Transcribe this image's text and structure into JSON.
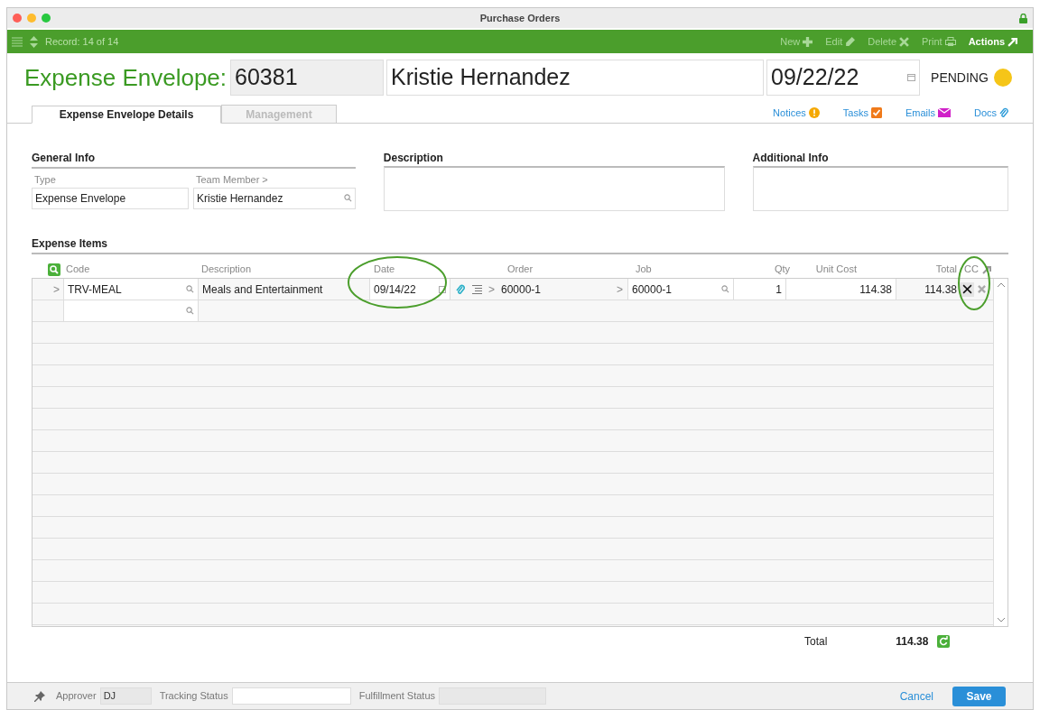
{
  "window": {
    "title": "Purchase Orders"
  },
  "toolbar": {
    "record": "Record: 14 of 14",
    "actions": [
      {
        "label": "New",
        "kind": "plus",
        "disabled": true
      },
      {
        "label": "Edit",
        "kind": "pencil",
        "disabled": true
      },
      {
        "label": "Delete",
        "kind": "x",
        "disabled": true
      },
      {
        "label": "Print",
        "kind": "printer",
        "disabled": true
      },
      {
        "label": "Actions",
        "kind": "arrow",
        "disabled": false
      }
    ]
  },
  "header": {
    "title": "Expense Envelope:",
    "number": "60381",
    "name": "Kristie Hernandez",
    "date": "09/22/22",
    "status": {
      "label": "PENDING",
      "color": "#f5c518"
    }
  },
  "tabs": [
    {
      "label": "Expense Envelope Details",
      "selected": true
    },
    {
      "label": "Management",
      "selected": false
    }
  ],
  "links": [
    {
      "label": "Notices",
      "kind": "alert"
    },
    {
      "label": "Tasks",
      "kind": "check"
    },
    {
      "label": "Emails",
      "kind": "mail"
    },
    {
      "label": "Docs",
      "kind": "clip"
    }
  ],
  "general_info": {
    "title": "General Info",
    "type_label": "Type",
    "type_value": "Expense Envelope",
    "member_label": "Team Member >",
    "member_value": "Kristie Hernandez"
  },
  "description": {
    "title": "Description"
  },
  "additional_info": {
    "title": "Additional Info"
  },
  "expense_items": {
    "title": "Expense Items",
    "columns": [
      "Code",
      "Description",
      "Date",
      "Order",
      "Job",
      "Qty",
      "Unit Cost",
      "Total",
      "CC"
    ],
    "rows": [
      {
        "marker": ">",
        "code": "TRV-MEAL",
        "description": "Meals and Entertainment",
        "date": "09/14/22",
        "order_marker": ">",
        "order": "60000-1",
        "job_marker": ">",
        "job": "60000-1",
        "qty": "1",
        "unit_cost": "114.38",
        "total": "114.38",
        "cc": true
      }
    ],
    "total_label": "Total",
    "total_value": "114.38"
  },
  "footer": {
    "approver_label": "Approver",
    "approver_value": "DJ",
    "tracking_label": "Tracking Status",
    "fulfillment_label": "Fulfillment Status",
    "cancel": "Cancel",
    "save": "Save"
  }
}
